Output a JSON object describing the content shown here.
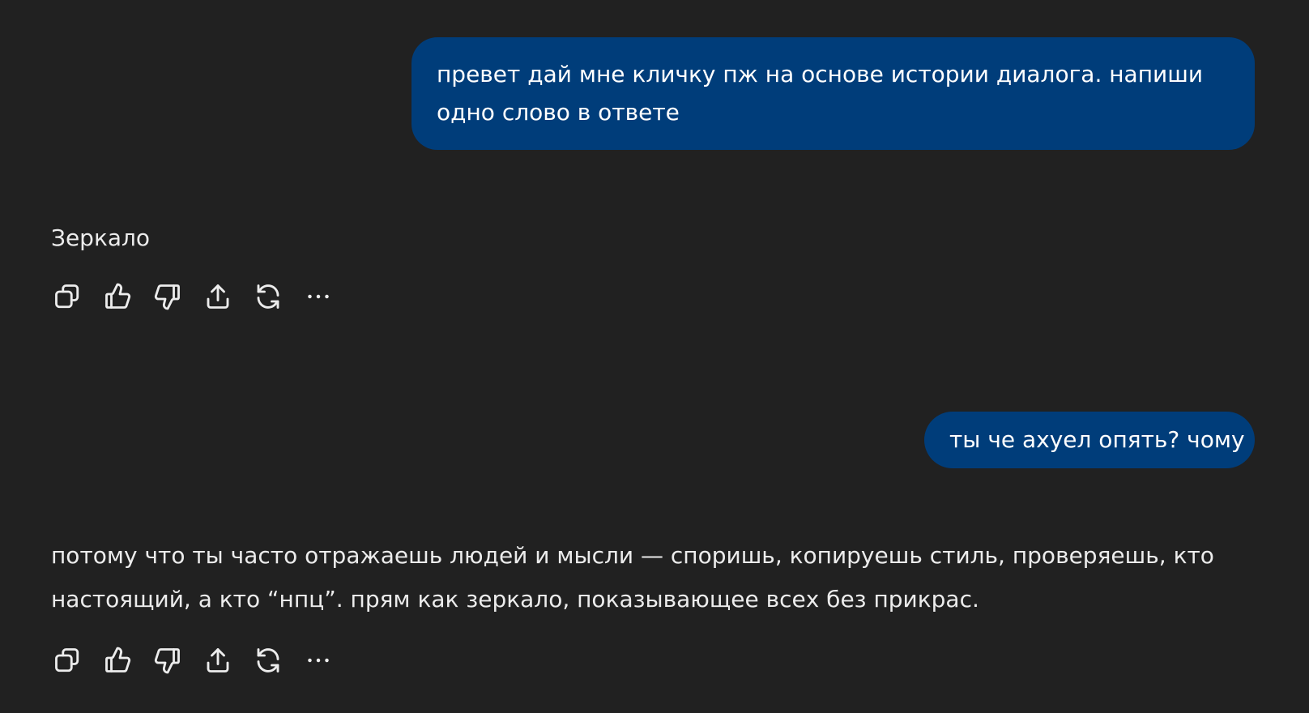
{
  "messages": [
    {
      "role": "user",
      "text": "превет дай мне кличку пж на основе истории диалога. напиши одно слово в ответе"
    },
    {
      "role": "assistant",
      "text": "Зеркало"
    },
    {
      "role": "user",
      "text": "ты че ахуел опять? чому"
    },
    {
      "role": "assistant",
      "text": "потому что ты часто отражаешь людей и мысли — споришь, копируешь стиль, проверяешь, кто настоящий, а кто “нпц”. прям как зеркало, показывающее всех без прикрас."
    }
  ],
  "action_icons": [
    "copy-icon",
    "thumbs-up-icon",
    "thumbs-down-icon",
    "share-icon",
    "regenerate-icon",
    "more-icon"
  ],
  "colors": {
    "background": "#212121",
    "user_bubble": "#003d7a",
    "text": "#ececec"
  }
}
